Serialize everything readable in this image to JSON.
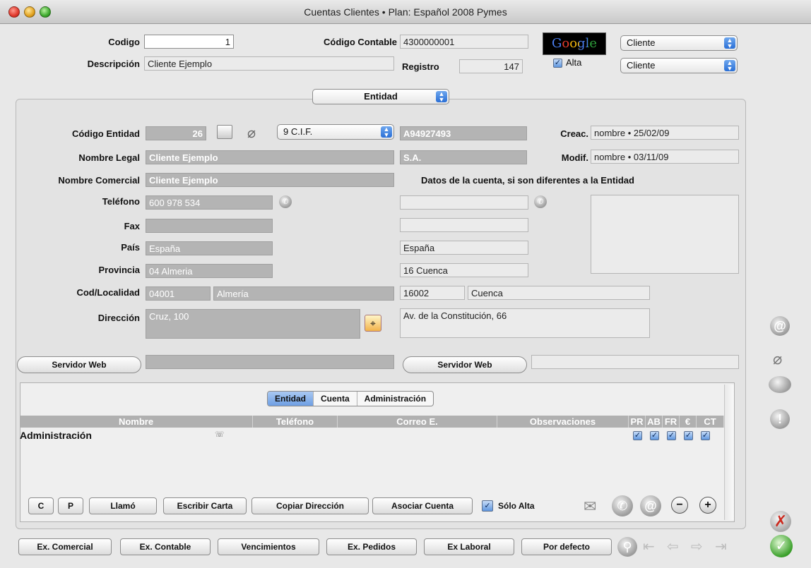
{
  "window": {
    "title": "Cuentas Clientes • Plan: Español 2008 Pymes"
  },
  "header": {
    "codigo_label": "Codigo",
    "codigo_value": "1",
    "codigo_contable_label": "Código Contable",
    "codigo_contable_value": "4300000001",
    "descripcion_label": "Descripción",
    "descripcion_value": "Cliente Ejemplo",
    "registro_label": "Registro",
    "registro_value": "147",
    "google_label": "Google",
    "alta_label": "Alta",
    "type_select_1": "Cliente",
    "type_select_2": "Cliente"
  },
  "entity_selector": "Entidad",
  "entity": {
    "codigo_entidad_label": "Código Entidad",
    "codigo_entidad_value": "26",
    "id_type": "9 C.I.F.",
    "id_value": "A94927493",
    "creac_label": "Creac.",
    "creac_value": "nombre • 25/02/09",
    "modif_label": "Modif.",
    "modif_value": "nombre • 03/11/09",
    "nombre_legal_label": "Nombre Legal",
    "nombre_legal_value": "Cliente Ejemplo",
    "forma_juridica": "S.A.",
    "nombre_comercial_label": "Nombre Comercial",
    "nombre_comercial_value": "Cliente Ejemplo",
    "datos_cuenta_heading": "Datos de la cuenta, si son diferentes a la Entidad",
    "telefono_label": "Teléfono",
    "telefono_value": "600 978 534",
    "telefono_cuenta": "",
    "fax_label": "Fax",
    "fax_value": "",
    "fax_cuenta": "",
    "pais_label": "País",
    "pais_value": "España",
    "pais_cuenta": "España",
    "provincia_label": "Provincia",
    "provincia_value": "04 Almeria",
    "provincia_cuenta": "16 Cuenca",
    "cod_localidad_label": "Cod/Localidad",
    "cp_value": "04001",
    "localidad_value": "Almería",
    "cp_cuenta": "16002",
    "localidad_cuenta": "Cuenca",
    "direccion_label": "Dirección",
    "direccion_value": "Cruz, 100",
    "direccion_cuenta": "Av. de la Constitución, 66",
    "servidor_web_label": "Servidor Web",
    "servidor_web_value": "",
    "servidor_web_cuenta": ""
  },
  "contacts": {
    "tabs": [
      "Entidad",
      "Cuenta",
      "Administración"
    ],
    "active_tab": "Entidad",
    "columns": [
      "Nombre",
      "Teléfono",
      "Correo E.",
      "Observaciones"
    ],
    "flag_columns": [
      "PR",
      "AB",
      "FR",
      "€",
      "CT"
    ],
    "rows": [
      {
        "nombre": "Administración",
        "telefono": "",
        "correo": "",
        "observaciones": "",
        "flags": [
          true,
          true,
          true,
          true,
          true
        ]
      }
    ],
    "buttons": {
      "c": "C",
      "p": "P",
      "llamo": "Llamó",
      "escribir_carta": "Escribir Carta",
      "copiar_direccion": "Copiar Dirección",
      "asociar_cuenta": "Asociar Cuenta",
      "solo_alta": "Sólo Alta"
    }
  },
  "footer": {
    "ex_comercial": "Ex. Comercial",
    "ex_contable": "Ex. Contable",
    "vencimientos": "Vencimientos",
    "ex_pedidos": "Ex. Pedidos",
    "ex_laboral": "Ex Laboral",
    "por_defecto": "Por defecto"
  },
  "colors": {
    "accent": "#2a6fd6",
    "cancel": "#cc2a1e",
    "ok": "#3aa02a"
  }
}
